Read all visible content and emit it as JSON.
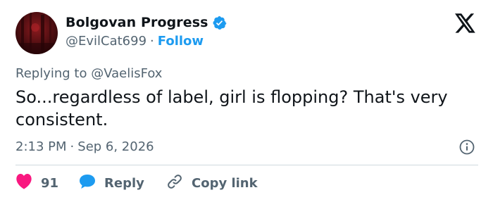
{
  "author": {
    "display_name": "Bolgovan Progress",
    "handle": "@EvilCat699",
    "separator": "·",
    "follow_label": "Follow",
    "verified": true
  },
  "icons": {
    "brand": "x-logo-icon",
    "verified": "verified-badge-icon",
    "info": "info-icon",
    "like": "heart-icon",
    "reply": "speech-bubble-icon",
    "copy": "link-icon"
  },
  "tweet": {
    "replying_to": "Replying to @VaelisFox",
    "text": "So...regardless of label, girl is flopping? That's very consistent.",
    "time": "2:13 PM",
    "separator": "·",
    "date": "Sep 6, 2026"
  },
  "actions": {
    "like_count": "91",
    "reply_label": "Reply",
    "copy_label": "Copy link"
  },
  "colors": {
    "accent": "#1d9bf0",
    "like": "#f91880",
    "text": "#0f1419",
    "secondary": "#536471",
    "divider": "#cfd9de"
  }
}
